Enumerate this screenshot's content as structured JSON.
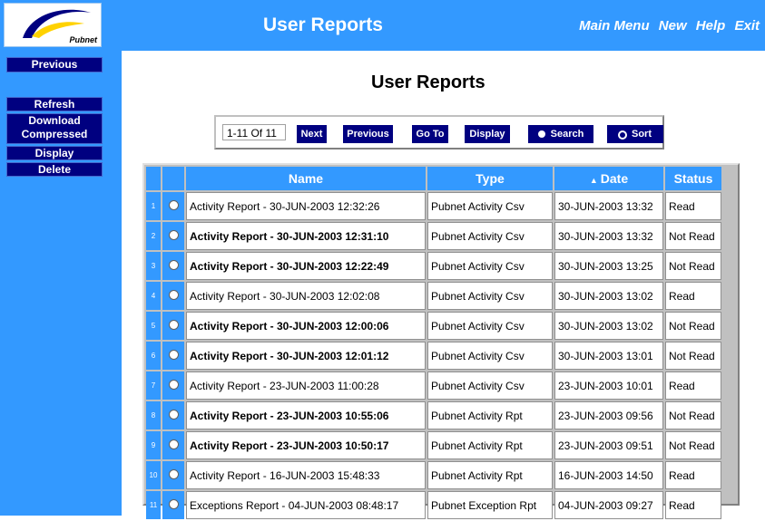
{
  "header": {
    "logo_text": "Pubnet",
    "title": "User Reports",
    "menu": [
      "Main Menu",
      "New",
      "Help",
      "Exit"
    ]
  },
  "sidebar": {
    "previous": "Previous",
    "refresh": "Refresh",
    "download_line1": "Download",
    "download_line2": "Compressed",
    "display": "Display",
    "delete": "Delete"
  },
  "main": {
    "title": "User Reports",
    "range": "1-11 Of 11",
    "buttons": {
      "next": "Next",
      "previous": "Previous",
      "goto": "Go To",
      "display": "Display",
      "search": "Search",
      "sort": "Sort"
    }
  },
  "table": {
    "headers": [
      "Name",
      "Type",
      "Date",
      "Status"
    ],
    "sort_indicator": "▲",
    "rows": [
      {
        "num": "1",
        "name": "Activity Report - 30-JUN-2003 12:32:26",
        "type": "Pubnet Activity Csv",
        "date": "30-JUN-2003 13:32",
        "status": "Read",
        "bold": false
      },
      {
        "num": "2",
        "name": "Activity Report - 30-JUN-2003 12:31:10",
        "type": "Pubnet Activity Csv",
        "date": "30-JUN-2003 13:32",
        "status": "Not Read",
        "bold": true
      },
      {
        "num": "3",
        "name": "Activity Report - 30-JUN-2003 12:22:49",
        "type": "Pubnet Activity Csv",
        "date": "30-JUN-2003 13:25",
        "status": "Not Read",
        "bold": true
      },
      {
        "num": "4",
        "name": "Activity Report - 30-JUN-2003 12:02:08",
        "type": "Pubnet Activity Csv",
        "date": "30-JUN-2003 13:02",
        "status": "Read",
        "bold": false
      },
      {
        "num": "5",
        "name": "Activity Report - 30-JUN-2003 12:00:06",
        "type": "Pubnet Activity Csv",
        "date": "30-JUN-2003 13:02",
        "status": "Not Read",
        "bold": true
      },
      {
        "num": "6",
        "name": "Activity Report - 30-JUN-2003 12:01:12",
        "type": "Pubnet Activity Csv",
        "date": "30-JUN-2003 13:01",
        "status": "Not Read",
        "bold": true
      },
      {
        "num": "7",
        "name": "Activity Report - 23-JUN-2003 11:00:28",
        "type": "Pubnet Activity Csv",
        "date": "23-JUN-2003 10:01",
        "status": "Read",
        "bold": false
      },
      {
        "num": "8",
        "name": "Activity Report - 23-JUN-2003 10:55:06",
        "type": "Pubnet Activity Rpt",
        "date": "23-JUN-2003 09:56",
        "status": "Not Read",
        "bold": true
      },
      {
        "num": "9",
        "name": "Activity Report - 23-JUN-2003 10:50:17",
        "type": "Pubnet Activity Rpt",
        "date": "23-JUN-2003 09:51",
        "status": "Not Read",
        "bold": true
      },
      {
        "num": "10",
        "name": "Activity Report - 16-JUN-2003 15:48:33",
        "type": "Pubnet Activity Rpt",
        "date": "16-JUN-2003 14:50",
        "status": "Read",
        "bold": false
      },
      {
        "num": "11",
        "name": "Exceptions Report - 04-JUN-2003 08:48:17",
        "type": "Pubnet Exception Rpt",
        "date": "04-JUN-2003 09:27",
        "status": "Read",
        "bold": false
      }
    ]
  },
  "colors": {
    "accent": "#3399ff",
    "button": "#000080"
  }
}
